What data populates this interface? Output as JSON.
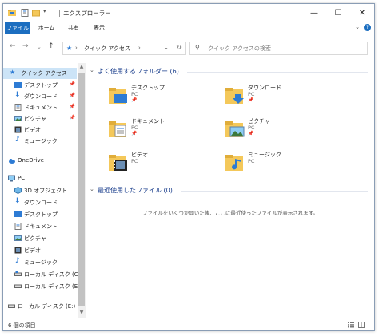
{
  "window": {
    "title": "エクスプローラー",
    "controls": {
      "minimize": "—",
      "maximize": "☐",
      "close": "✕"
    }
  },
  "ribbon": {
    "tabs": [
      "ファイル",
      "ホーム",
      "共有",
      "表示"
    ]
  },
  "address": {
    "path": "クイック アクセス",
    "separator": "›",
    "search_placeholder": "クイック アクセスの検索"
  },
  "nav": {
    "items": [
      {
        "label": "クイック アクセス",
        "icon": "star-icon",
        "selected": true,
        "pinned": false
      },
      {
        "label": "デスクトップ",
        "icon": "desktop-folder-icon",
        "pinned": true
      },
      {
        "label": "ダウンロード",
        "icon": "download-arrow-icon",
        "pinned": true
      },
      {
        "label": "ドキュメント",
        "icon": "document-folder-icon",
        "pinned": true
      },
      {
        "label": "ピクチャ",
        "icon": "picture-folder-icon",
        "pinned": true
      },
      {
        "label": "ビデオ",
        "icon": "video-folder-icon",
        "pinned": false
      },
      {
        "label": "ミュージック",
        "icon": "music-note-icon",
        "pinned": false
      },
      {
        "label": "OneDrive",
        "icon": "cloud-icon",
        "pinned": false
      },
      {
        "label": "PC",
        "icon": "pc-icon",
        "pinned": false
      },
      {
        "label": "3D オブジェクト",
        "icon": "cube-icon",
        "pinned": false
      },
      {
        "label": "ダウンロード",
        "icon": "download-arrow-icon",
        "pinned": false
      },
      {
        "label": "デスクトップ",
        "icon": "desktop-folder-icon",
        "pinned": false
      },
      {
        "label": "ドキュメント",
        "icon": "document-folder-icon",
        "pinned": false
      },
      {
        "label": "ピクチャ",
        "icon": "picture-folder-icon",
        "pinned": false
      },
      {
        "label": "ビデオ",
        "icon": "video-folder-icon",
        "pinned": false
      },
      {
        "label": "ミュージック",
        "icon": "music-note-icon",
        "pinned": false
      },
      {
        "label": "ローカル ディスク (C",
        "icon": "drive-icon",
        "pinned": false
      },
      {
        "label": "ローカル ディスク (E",
        "icon": "drive-icon",
        "pinned": false
      },
      {
        "label": "ローカル ディスク (E:)",
        "icon": "drive-icon",
        "pinned": false
      }
    ]
  },
  "frequent": {
    "heading": "よく使用するフォルダー (6)",
    "folders": [
      {
        "name": "デスクトップ",
        "location": "PC",
        "icon": "desktop-folder-icon",
        "pinned": true
      },
      {
        "name": "ダウンロード",
        "location": "PC",
        "icon": "download-folder-icon",
        "pinned": true
      },
      {
        "name": "ドキュメント",
        "location": "PC",
        "icon": "document-folder-icon",
        "pinned": true
      },
      {
        "name": "ピクチャ",
        "location": "PC",
        "icon": "picture-folder-icon",
        "pinned": true
      },
      {
        "name": "ビデオ",
        "location": "PC",
        "icon": "video-folder-icon",
        "pinned": false
      },
      {
        "name": "ミュージック",
        "location": "PC",
        "icon": "music-folder-icon",
        "pinned": false
      }
    ]
  },
  "recent": {
    "heading": "最近使用したファイル (0)",
    "empty_message": "ファイルをいくつか開いた後、ここに最近使ったファイルが表示されます。"
  },
  "status": {
    "text": "6 個の項目"
  },
  "colors": {
    "accent": "#1c6ec0",
    "selection": "#cce4f7",
    "folder": "#f4c85a",
    "heading": "#1a3e8c"
  }
}
